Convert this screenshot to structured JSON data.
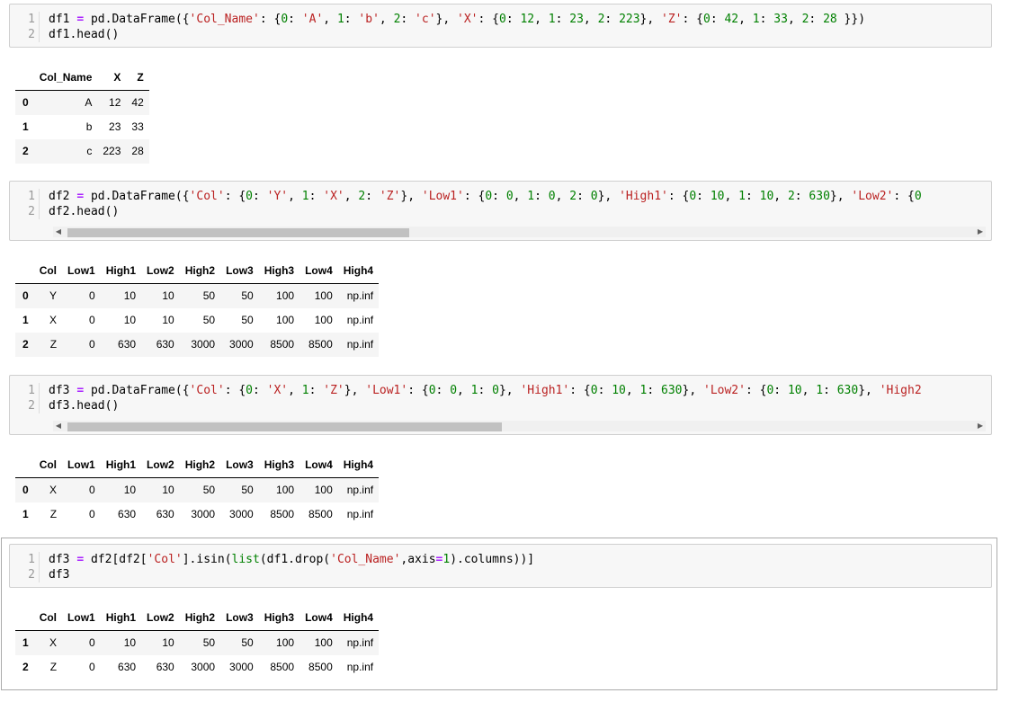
{
  "cells": [
    {
      "lines": [
        {
          "num": "1",
          "tokens": [
            {
              "t": "df1 ",
              "c": "v"
            },
            {
              "t": "=",
              "c": "o"
            },
            {
              "t": " pd.DataFrame({",
              "c": "v"
            },
            {
              "t": "'Col_Name'",
              "c": "s"
            },
            {
              "t": ": {",
              "c": "v"
            },
            {
              "t": "0",
              "c": "n"
            },
            {
              "t": ": ",
              "c": "v"
            },
            {
              "t": "'A'",
              "c": "s"
            },
            {
              "t": ", ",
              "c": "v"
            },
            {
              "t": "1",
              "c": "n"
            },
            {
              "t": ": ",
              "c": "v"
            },
            {
              "t": "'b'",
              "c": "s"
            },
            {
              "t": ", ",
              "c": "v"
            },
            {
              "t": "2",
              "c": "n"
            },
            {
              "t": ": ",
              "c": "v"
            },
            {
              "t": "'c'",
              "c": "s"
            },
            {
              "t": "}, ",
              "c": "v"
            },
            {
              "t": "'X'",
              "c": "s"
            },
            {
              "t": ": {",
              "c": "v"
            },
            {
              "t": "0",
              "c": "n"
            },
            {
              "t": ": ",
              "c": "v"
            },
            {
              "t": "12",
              "c": "n"
            },
            {
              "t": ", ",
              "c": "v"
            },
            {
              "t": "1",
              "c": "n"
            },
            {
              "t": ": ",
              "c": "v"
            },
            {
              "t": "23",
              "c": "n"
            },
            {
              "t": ", ",
              "c": "v"
            },
            {
              "t": "2",
              "c": "n"
            },
            {
              "t": ": ",
              "c": "v"
            },
            {
              "t": "223",
              "c": "n"
            },
            {
              "t": "}, ",
              "c": "v"
            },
            {
              "t": "'Z'",
              "c": "s"
            },
            {
              "t": ": {",
              "c": "v"
            },
            {
              "t": "0",
              "c": "n"
            },
            {
              "t": ": ",
              "c": "v"
            },
            {
              "t": "42",
              "c": "n"
            },
            {
              "t": ", ",
              "c": "v"
            },
            {
              "t": "1",
              "c": "n"
            },
            {
              "t": ": ",
              "c": "v"
            },
            {
              "t": "33",
              "c": "n"
            },
            {
              "t": ", ",
              "c": "v"
            },
            {
              "t": "2",
              "c": "n"
            },
            {
              "t": ": ",
              "c": "v"
            },
            {
              "t": "28",
              "c": "n"
            },
            {
              "t": " }})",
              "c": "v"
            }
          ]
        },
        {
          "num": "2",
          "tokens": [
            {
              "t": "df1.head()",
              "c": "v"
            }
          ]
        }
      ]
    },
    {
      "lines": [
        {
          "num": "1",
          "tokens": [
            {
              "t": "df2 ",
              "c": "v"
            },
            {
              "t": "=",
              "c": "o"
            },
            {
              "t": " pd.DataFrame({",
              "c": "v"
            },
            {
              "t": "'Col'",
              "c": "s"
            },
            {
              "t": ": {",
              "c": "v"
            },
            {
              "t": "0",
              "c": "n"
            },
            {
              "t": ": ",
              "c": "v"
            },
            {
              "t": "'Y'",
              "c": "s"
            },
            {
              "t": ", ",
              "c": "v"
            },
            {
              "t": "1",
              "c": "n"
            },
            {
              "t": ": ",
              "c": "v"
            },
            {
              "t": "'X'",
              "c": "s"
            },
            {
              "t": ", ",
              "c": "v"
            },
            {
              "t": "2",
              "c": "n"
            },
            {
              "t": ": ",
              "c": "v"
            },
            {
              "t": "'Z'",
              "c": "s"
            },
            {
              "t": "}, ",
              "c": "v"
            },
            {
              "t": "'Low1'",
              "c": "s"
            },
            {
              "t": ": {",
              "c": "v"
            },
            {
              "t": "0",
              "c": "n"
            },
            {
              "t": ": ",
              "c": "v"
            },
            {
              "t": "0",
              "c": "n"
            },
            {
              "t": ", ",
              "c": "v"
            },
            {
              "t": "1",
              "c": "n"
            },
            {
              "t": ": ",
              "c": "v"
            },
            {
              "t": "0",
              "c": "n"
            },
            {
              "t": ", ",
              "c": "v"
            },
            {
              "t": "2",
              "c": "n"
            },
            {
              "t": ": ",
              "c": "v"
            },
            {
              "t": "0",
              "c": "n"
            },
            {
              "t": "}, ",
              "c": "v"
            },
            {
              "t": "'High1'",
              "c": "s"
            },
            {
              "t": ": {",
              "c": "v"
            },
            {
              "t": "0",
              "c": "n"
            },
            {
              "t": ": ",
              "c": "v"
            },
            {
              "t": "10",
              "c": "n"
            },
            {
              "t": ", ",
              "c": "v"
            },
            {
              "t": "1",
              "c": "n"
            },
            {
              "t": ": ",
              "c": "v"
            },
            {
              "t": "10",
              "c": "n"
            },
            {
              "t": ", ",
              "c": "v"
            },
            {
              "t": "2",
              "c": "n"
            },
            {
              "t": ": ",
              "c": "v"
            },
            {
              "t": "630",
              "c": "n"
            },
            {
              "t": "}, ",
              "c": "v"
            },
            {
              "t": "'Low2'",
              "c": "s"
            },
            {
              "t": ": {",
              "c": "v"
            },
            {
              "t": "0",
              "c": "n"
            }
          ]
        },
        {
          "num": "2",
          "tokens": [
            {
              "t": "df2.head()",
              "c": "v"
            }
          ]
        }
      ]
    },
    {
      "lines": [
        {
          "num": "1",
          "tokens": [
            {
              "t": "df3 ",
              "c": "v"
            },
            {
              "t": "=",
              "c": "o"
            },
            {
              "t": " pd.DataFrame({",
              "c": "v"
            },
            {
              "t": "'Col'",
              "c": "s"
            },
            {
              "t": ": {",
              "c": "v"
            },
            {
              "t": "0",
              "c": "n"
            },
            {
              "t": ": ",
              "c": "v"
            },
            {
              "t": "'X'",
              "c": "s"
            },
            {
              "t": ", ",
              "c": "v"
            },
            {
              "t": "1",
              "c": "n"
            },
            {
              "t": ": ",
              "c": "v"
            },
            {
              "t": "'Z'",
              "c": "s"
            },
            {
              "t": "}, ",
              "c": "v"
            },
            {
              "t": "'Low1'",
              "c": "s"
            },
            {
              "t": ": {",
              "c": "v"
            },
            {
              "t": "0",
              "c": "n"
            },
            {
              "t": ": ",
              "c": "v"
            },
            {
              "t": "0",
              "c": "n"
            },
            {
              "t": ", ",
              "c": "v"
            },
            {
              "t": "1",
              "c": "n"
            },
            {
              "t": ": ",
              "c": "v"
            },
            {
              "t": "0",
              "c": "n"
            },
            {
              "t": "}, ",
              "c": "v"
            },
            {
              "t": "'High1'",
              "c": "s"
            },
            {
              "t": ": {",
              "c": "v"
            },
            {
              "t": "0",
              "c": "n"
            },
            {
              "t": ": ",
              "c": "v"
            },
            {
              "t": "10",
              "c": "n"
            },
            {
              "t": ", ",
              "c": "v"
            },
            {
              "t": "1",
              "c": "n"
            },
            {
              "t": ": ",
              "c": "v"
            },
            {
              "t": "630",
              "c": "n"
            },
            {
              "t": "}, ",
              "c": "v"
            },
            {
              "t": "'Low2'",
              "c": "s"
            },
            {
              "t": ": {",
              "c": "v"
            },
            {
              "t": "0",
              "c": "n"
            },
            {
              "t": ": ",
              "c": "v"
            },
            {
              "t": "10",
              "c": "n"
            },
            {
              "t": ", ",
              "c": "v"
            },
            {
              "t": "1",
              "c": "n"
            },
            {
              "t": ": ",
              "c": "v"
            },
            {
              "t": "630",
              "c": "n"
            },
            {
              "t": "}, ",
              "c": "v"
            },
            {
              "t": "'High2",
              "c": "s"
            }
          ]
        },
        {
          "num": "2",
          "tokens": [
            {
              "t": "df3.head()",
              "c": "v"
            }
          ]
        }
      ]
    },
    {
      "lines": [
        {
          "num": "1",
          "tokens": [
            {
              "t": "df3 ",
              "c": "v"
            },
            {
              "t": "=",
              "c": "o"
            },
            {
              "t": " df2[df2[",
              "c": "v"
            },
            {
              "t": "'Col'",
              "c": "s"
            },
            {
              "t": "].isin(",
              "c": "v"
            },
            {
              "t": "list",
              "c": "b"
            },
            {
              "t": "(df1.drop(",
              "c": "v"
            },
            {
              "t": "'Col_Name'",
              "c": "s"
            },
            {
              "t": ",axis",
              "c": "v"
            },
            {
              "t": "=",
              "c": "o"
            },
            {
              "t": "1",
              "c": "n"
            },
            {
              "t": ").columns))]",
              "c": "v"
            }
          ]
        },
        {
          "num": "2",
          "tokens": [
            {
              "t": "df3",
              "c": "v"
            }
          ]
        }
      ]
    }
  ],
  "tables": [
    {
      "columns": [
        "",
        "Col_Name",
        "X",
        "Z"
      ],
      "rows": [
        [
          "0",
          "A",
          "12",
          "42"
        ],
        [
          "1",
          "b",
          "23",
          "33"
        ],
        [
          "2",
          "c",
          "223",
          "28"
        ]
      ]
    },
    {
      "columns": [
        "",
        "Col",
        "Low1",
        "High1",
        "Low2",
        "High2",
        "Low3",
        "High3",
        "Low4",
        "High4"
      ],
      "rows": [
        [
          "0",
          "Y",
          "0",
          "10",
          "10",
          "50",
          "50",
          "100",
          "100",
          "np.inf"
        ],
        [
          "1",
          "X",
          "0",
          "10",
          "10",
          "50",
          "50",
          "100",
          "100",
          "np.inf"
        ],
        [
          "2",
          "Z",
          "0",
          "630",
          "630",
          "3000",
          "3000",
          "8500",
          "8500",
          "np.inf"
        ]
      ]
    },
    {
      "columns": [
        "",
        "Col",
        "Low1",
        "High1",
        "Low2",
        "High2",
        "Low3",
        "High3",
        "Low4",
        "High4"
      ],
      "rows": [
        [
          "0",
          "X",
          "0",
          "10",
          "10",
          "50",
          "50",
          "100",
          "100",
          "np.inf"
        ],
        [
          "1",
          "Z",
          "0",
          "630",
          "630",
          "3000",
          "3000",
          "8500",
          "8500",
          "np.inf"
        ]
      ]
    },
    {
      "columns": [
        "",
        "Col",
        "Low1",
        "High1",
        "Low2",
        "High2",
        "Low3",
        "High3",
        "Low4",
        "High4"
      ],
      "rows": [
        [
          "1",
          "X",
          "0",
          "10",
          "10",
          "50",
          "50",
          "100",
          "100",
          "np.inf"
        ],
        [
          "2",
          "Z",
          "0",
          "630",
          "630",
          "3000",
          "3000",
          "8500",
          "8500",
          "np.inf"
        ]
      ]
    }
  ],
  "scroll": {
    "left_arrow": "◀",
    "right_arrow": "▶"
  },
  "colors": {
    "string": "#ba2121",
    "number": "#008000",
    "operator": "#aa22ff",
    "builtin": "#008000"
  }
}
